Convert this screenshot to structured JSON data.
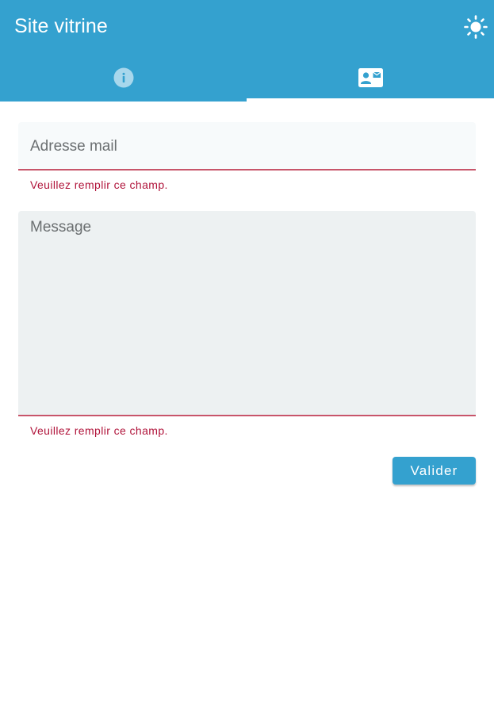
{
  "header": {
    "title": "Site vitrine",
    "theme_icon": "sun-icon"
  },
  "tabs": [
    {
      "icon": "info-icon",
      "active": false
    },
    {
      "icon": "contact-card-icon",
      "active": true
    }
  ],
  "form": {
    "email": {
      "placeholder": "Adresse mail",
      "value": "",
      "error": "Veuillez remplir ce champ."
    },
    "message": {
      "placeholder": "Message",
      "value": "",
      "error": "Veuillez remplir ce champ."
    },
    "submit_label": "Valider"
  },
  "colors": {
    "primary": "#34a1cf",
    "error": "#b0133a",
    "error_underline": "#c8556a"
  }
}
